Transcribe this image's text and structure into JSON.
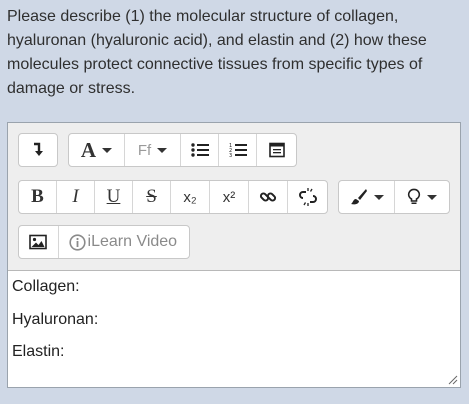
{
  "question": "Please describe (1) the molecular structure of collagen, hyaluronan (hyaluronic acid), and elastin and (2) how these molecules protect connective tissues from specific types of damage or stress.",
  "toolbar": {
    "row1": {
      "toggle_icon": "show-more-icon",
      "font_style_label": "A",
      "font_family_label": "Ff",
      "bullet_list_icon": "unordered-list-icon",
      "numbered_list_icon": "ordered-list-icon",
      "media_icon": "media-manager-icon"
    },
    "row2": {
      "bold_label": "B",
      "italic_label": "I",
      "underline_label": "U",
      "strike_label": "S",
      "subscript_label": "x₂",
      "superscript_label": "x²",
      "link_icon": "link-icon",
      "unlink_icon": "unlink-icon",
      "brush_icon": "paintbrush-icon",
      "bulb_icon": "lightbulb-icon"
    },
    "row3": {
      "image_icon": "image-icon",
      "ilearn_video_label": "iLearn Video",
      "ilearn_video_icon": "info-circle-icon"
    }
  },
  "editor_content": {
    "line1": "Collagen:",
    "line2": "Hyaluronan:",
    "line3": "Elastin:"
  }
}
